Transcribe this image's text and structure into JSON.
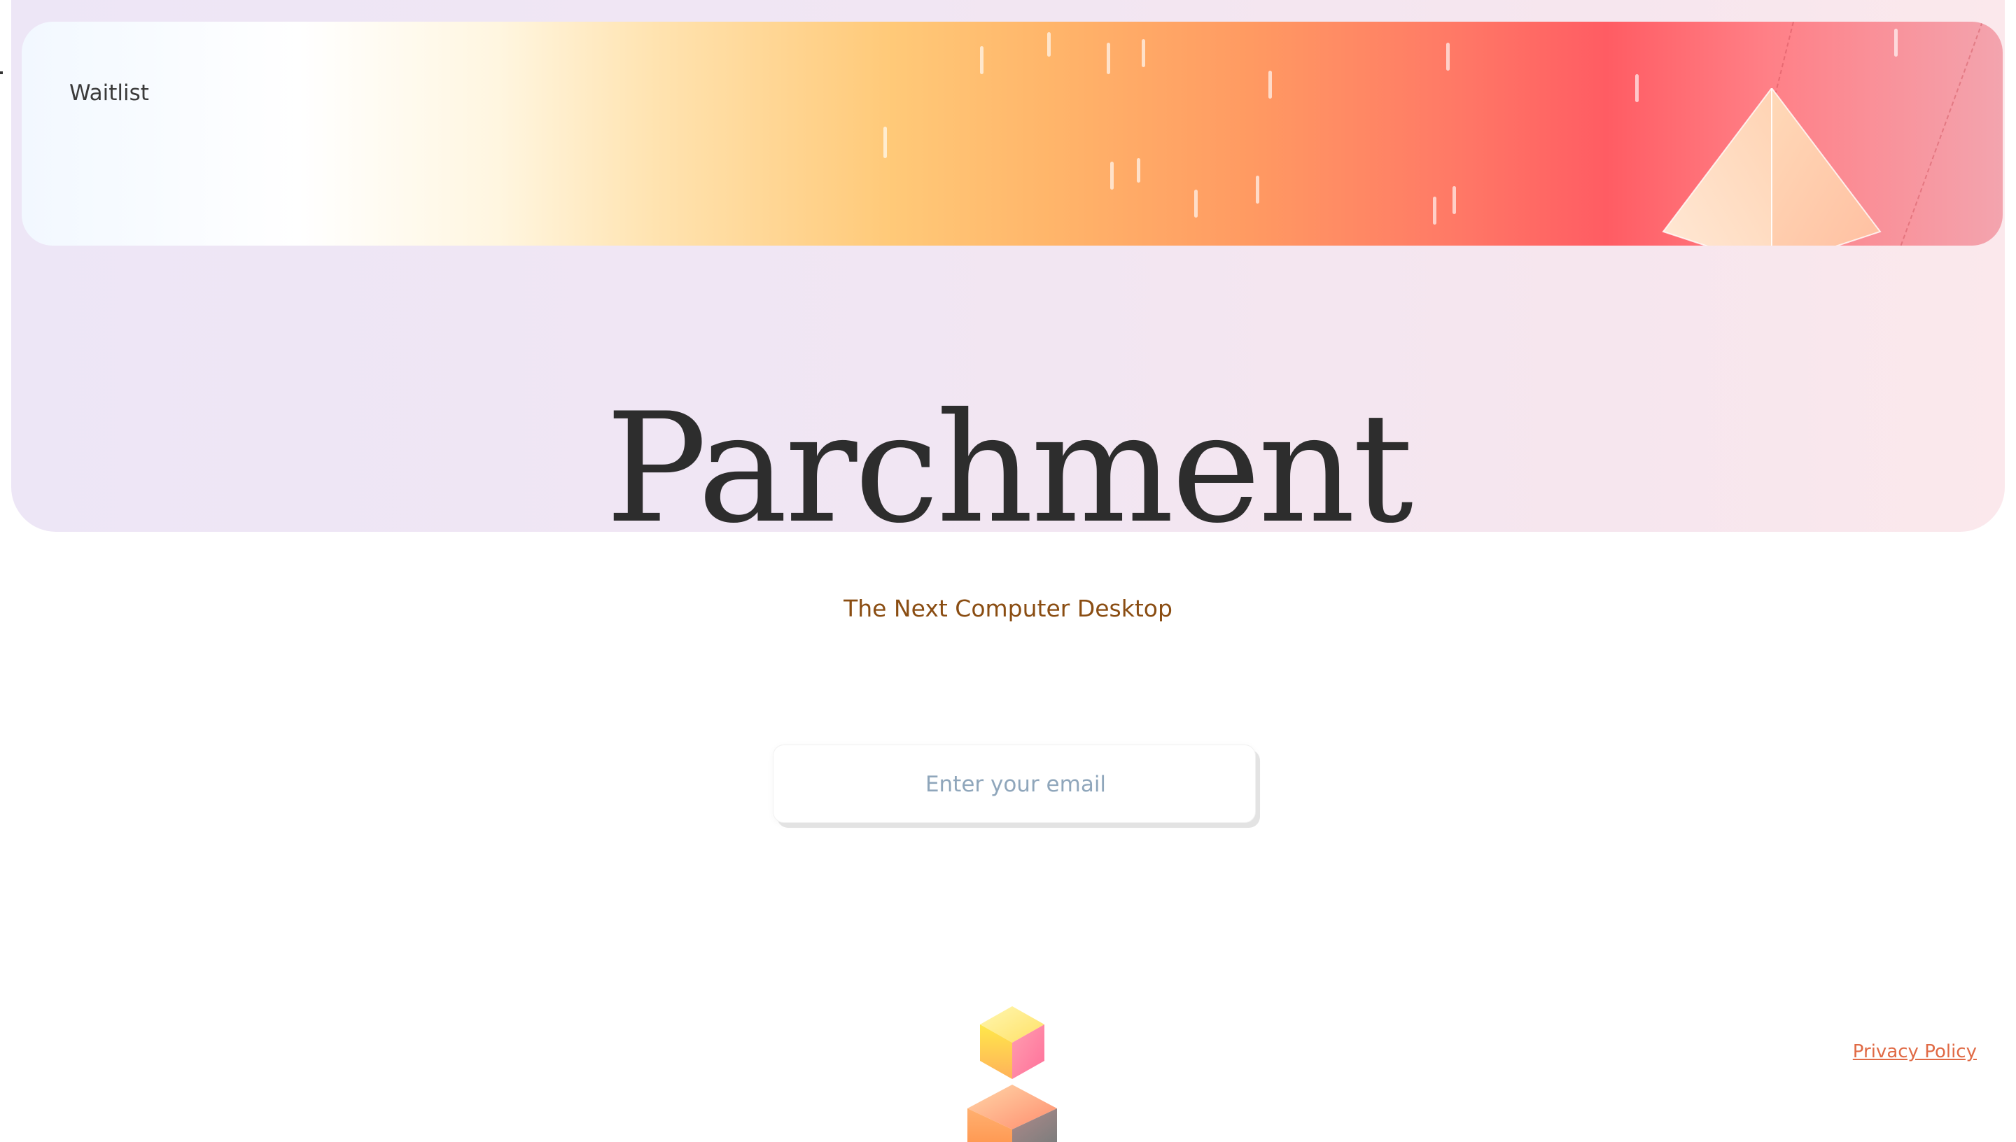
{
  "banner": {
    "label": "Waitlist"
  },
  "hero": {
    "title": "Parchment",
    "subtitle": "The Next Computer Desktop"
  },
  "signup": {
    "email_placeholder": "Enter your email",
    "email_value": ""
  },
  "footer": {
    "privacy_link": "Privacy Policy"
  },
  "icons": {
    "pyramid": "pyramid-icon",
    "cube_top": "cube-icon",
    "cube_bottom": "cube-icon"
  },
  "colors": {
    "title": "#2d2d2d",
    "subtitle": "#8a4d12",
    "link": "#e06a45",
    "placeholder": "#8fa6bb"
  }
}
